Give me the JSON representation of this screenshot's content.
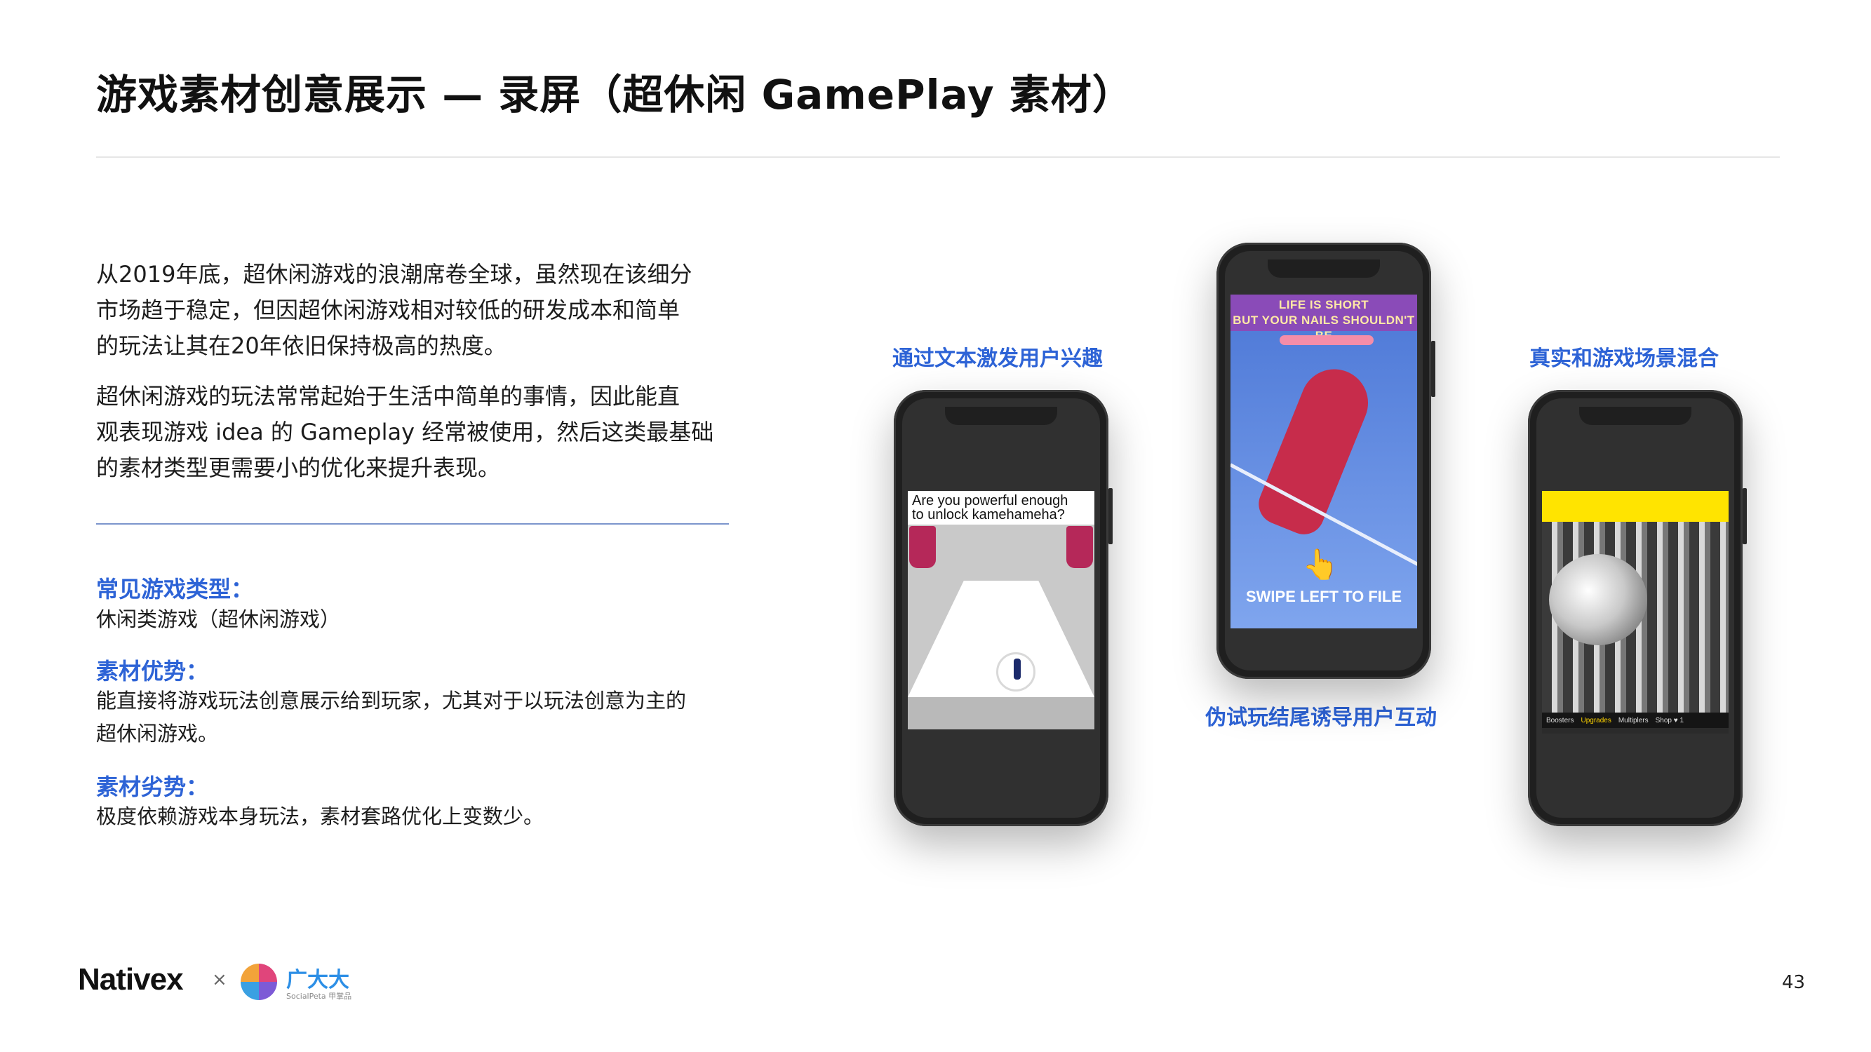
{
  "title": "游戏素材创意展示 — 录屏（超休闲 GamePlay 素材）",
  "intro": {
    "p1_lines": [
      "从2019年底，超休闲游戏的浪潮席卷全球，虽然现在该细分",
      "市场趋于稳定，但因超休闲游戏相对较低的研发成本和简单",
      "的玩法让其在20年依旧保持极高的热度。"
    ],
    "p2_lines": [
      "超休闲游戏的玩法常常起始于生活中简单的事情，因此能直",
      "观表现游戏 idea 的 Gameplay 经常被使用，然后这类最基础",
      "的素材类型更需要小的优化来提升表现。"
    ]
  },
  "sections": {
    "types_head": "常见游戏类型：",
    "types_body": "休闲类游戏（超休闲游戏）",
    "adv_head": "素材优势：",
    "adv_body_lines": [
      "能直接将游戏玩法创意展示给到玩家，尤其对于以玩法创意为主的",
      "超休闲游戏。"
    ],
    "disadv_head": "素材劣势：",
    "disadv_body": "极度依赖游戏本身玩法，素材套路优化上变数少。"
  },
  "phones": {
    "left_caption": "通过文本激发用户兴趣",
    "middle_caption": "伪试玩结尾诱导用户互动",
    "right_caption": "真实和游戏场景混合",
    "left_screen_text_lines": [
      "Are you powerful enough",
      "to unlock kamehameha?"
    ],
    "middle_banner_lines": [
      "LIFE IS SHORT",
      "BUT YOUR NAILS SHOULDN'T BE"
    ],
    "middle_swipe": "SWIPE LEFT TO FILE",
    "right_menu": [
      "Boosters",
      "Upgrades",
      "Multiplers",
      "Shop ♥ 1"
    ]
  },
  "footer": {
    "brand": "Nativex",
    "times": "×",
    "partner": "广大大",
    "partner_sub": "SocialPeta 甲掌品",
    "page_number": "43"
  },
  "colors": {
    "accent": "#2d63d6",
    "title": "#111111",
    "rule": "#7c95cc"
  }
}
